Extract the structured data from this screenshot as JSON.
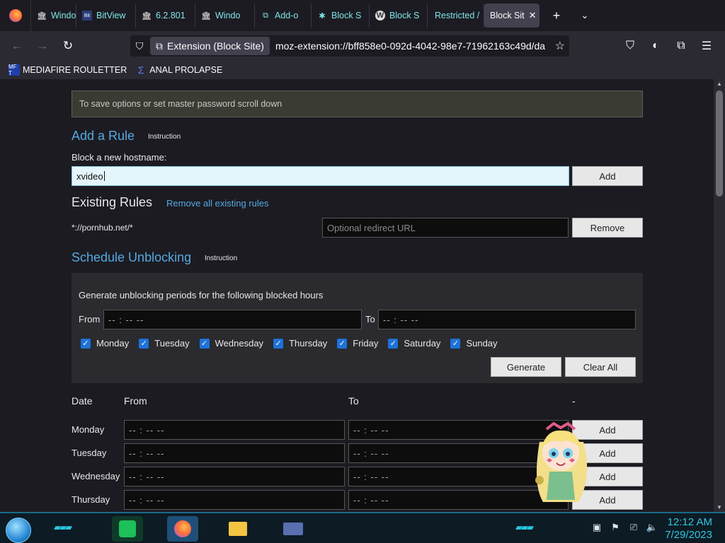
{
  "tabs": [
    {
      "label": "Windo",
      "icon": "bank-icon"
    },
    {
      "label": "BitView",
      "icon": "bitview-icon"
    },
    {
      "label": "6.2.801",
      "icon": "bank-icon"
    },
    {
      "label": "Windo",
      "icon": "bank-icon"
    },
    {
      "label": "Add-o",
      "icon": "addon-icon"
    },
    {
      "label": "Block S",
      "icon": "puzzle-icon"
    },
    {
      "label": "Block S",
      "icon": "w-icon"
    },
    {
      "label": "Restricted /",
      "icon": ""
    },
    {
      "label": "Block Sit",
      "icon": ""
    }
  ],
  "nav": {
    "identity": "Extension (Block Site)",
    "url": "moz-extension://bff858e0-092d-4042-98e7-71962163c49d/da"
  },
  "bookmarks": [
    {
      "label": "MEDIAFIRE ROULETTER",
      "icon": "MF T"
    },
    {
      "label": "ANAL PROLAPSE",
      "icon": "sigma"
    }
  ],
  "page": {
    "notice": "To save options or set master password scroll down",
    "add_rule_title": "Add a Rule",
    "instruction": "Instruction",
    "block_label": "Block a new hostname:",
    "host_value": "xvideo",
    "add_label": "Add",
    "existing_title": "Existing Rules",
    "remove_all": "Remove all existing rules",
    "rule_pattern": "*://pornhub.net/*",
    "redirect_placeholder": "Optional redirect URL",
    "remove_label": "Remove",
    "schedule_title": "Schedule Unblocking",
    "generate_text": "Generate unblocking periods for the following blocked hours",
    "from_label": "From",
    "to_label": "To",
    "time_placeholder": "-- : --   --",
    "days": [
      "Monday",
      "Tuesday",
      "Wednesday",
      "Thursday",
      "Friday",
      "Saturday",
      "Sunday"
    ],
    "generate_btn": "Generate",
    "clear_btn": "Clear All",
    "table_headers": {
      "date": "Date",
      "from": "From",
      "to": "To",
      "dash": "-"
    },
    "rows": [
      "Monday",
      "Tuesday",
      "Wednesday",
      "Thursday"
    ]
  },
  "taskbar": {
    "time": "12:12 AM",
    "date": "7/29/2023"
  },
  "colors": {
    "accent": "#54a9e1",
    "tab_text": "#7ee5e6",
    "checkbox": "#1e72d8",
    "clock": "#31c6df"
  }
}
